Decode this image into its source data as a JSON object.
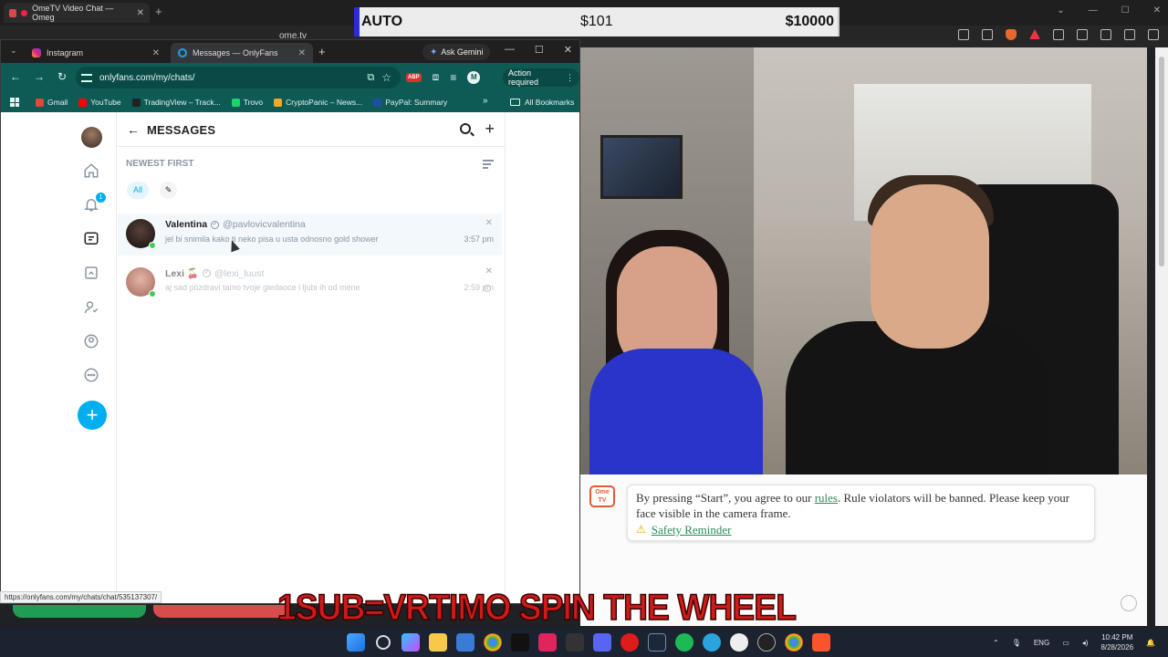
{
  "back_browser": {
    "tab_title": "OmeTV Video Chat — Omeg",
    "url": "ome.tv"
  },
  "price_bar": {
    "label": "AUTO",
    "value1": "$101",
    "value2": "$10000"
  },
  "front_browser": {
    "tabs": [
      {
        "label": "Instagram",
        "icon": "instagram-icon"
      },
      {
        "label": "Messages — OnlyFans",
        "icon": "onlyfans-icon"
      }
    ],
    "ask_gemini": "Ask Gemini",
    "url": "onlyfans.com/my/chats/",
    "action_required": "Action required",
    "profile_letter": "M",
    "abp_label": "ABP",
    "bookmarks": [
      {
        "label": "Gmail",
        "color": "#ea4335"
      },
      {
        "label": "YouTube",
        "color": "#ff0000"
      },
      {
        "label": "TradingView – Track...",
        "color": "#222222"
      },
      {
        "label": "Trovo",
        "color": "#19d66b"
      },
      {
        "label": "CryptoPanic – News...",
        "color": "#f5a623"
      },
      {
        "label": "PayPal: Summary",
        "color": "#1f4fa3"
      }
    ],
    "all_bookmarks": "All Bookmarks",
    "status_url": "https://onlyfans.com/my/chats/chat/535137307/"
  },
  "onlyfans": {
    "title": "MESSAGES",
    "sort_label": "NEWEST FIRST",
    "filter_all": "All",
    "notification_count": "1",
    "chats": [
      {
        "name": "Valentina",
        "handle": "@pavlovicvalentina",
        "preview": "jel bi snimila kako ti neko pisa u usta odnosno gold shower",
        "time": "3:57 pm"
      },
      {
        "name": "Lexi 🍒",
        "handle": "@lexi_luust",
        "preview": "aj sad pozdravi tamo tvoje gledaoce i ljubi ih od mene",
        "time": "2:59 pm"
      }
    ]
  },
  "ometv": {
    "logo_text": "Ome TV",
    "notice_pre": "By pressing “Start”, you agree to our ",
    "notice_link": "rules",
    "notice_post": ". Rule violators will be banned. Please keep your face visible in the camera frame.",
    "safety_link": "Safety Reminder"
  },
  "banner_text": "1SUB=VRTIMO SPIN THE WHEEL",
  "taskbar": {
    "language": "ENG",
    "time": "10:42 PM",
    "date": "8/28/2026"
  }
}
